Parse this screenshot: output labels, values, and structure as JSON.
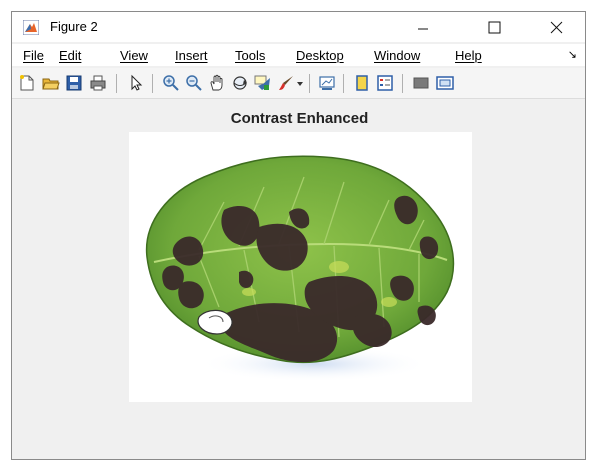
{
  "window": {
    "title": "Figure 2"
  },
  "window_controls": [
    "minimize",
    "maximize",
    "close"
  ],
  "menubar": {
    "items": [
      {
        "label": "File"
      },
      {
        "label": "Edit"
      },
      {
        "label": "View"
      },
      {
        "label": "Insert"
      },
      {
        "label": "Tools"
      },
      {
        "label": "Desktop"
      },
      {
        "label": "Window"
      },
      {
        "label": "Help"
      }
    ]
  },
  "toolbar": {
    "icons": [
      "new-figure-icon",
      "open-file-icon",
      "save-icon",
      "print-icon",
      "select-arrow-icon",
      "zoom-in-icon",
      "zoom-out-icon",
      "pan-hand-icon",
      "rotate-3d-icon",
      "data-cursor-icon",
      "brush-icon",
      "brush-dropdown-icon",
      "link-plot-icon",
      "insert-colorbar-icon",
      "insert-legend-icon",
      "hide-plot-tools-icon",
      "show-plot-tools-icon"
    ]
  },
  "axes": {
    "title": "Contrast Enhanced"
  },
  "colors": {
    "leaf_green": "#6fa83a",
    "lesion_dark": "#3a2a2a",
    "window_bg": "#f0f0f0",
    "matlab_orange": "#e8642a"
  }
}
